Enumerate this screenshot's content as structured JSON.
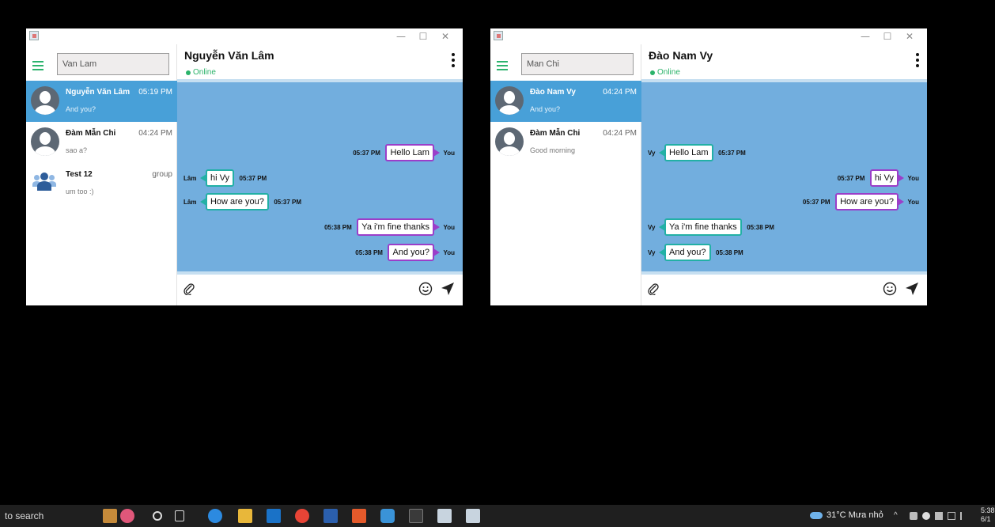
{
  "windows": [
    {
      "search": {
        "value": "Van Lam"
      },
      "conversations": [
        {
          "name": "Nguyễn Văn Lâm",
          "time": "05:19 PM",
          "last": "And you?",
          "active": true,
          "type": "user"
        },
        {
          "name": "Đàm Mẫn Chi",
          "time": "04:24 PM",
          "last": "sao a?",
          "active": false,
          "type": "user"
        },
        {
          "name": "Test 12",
          "time": "group",
          "last": "um too :)",
          "active": false,
          "type": "group"
        }
      ],
      "chat": {
        "title": "Nguyễn Văn Lâm",
        "status": "Online",
        "messages": [
          {
            "dir": "out",
            "sender": "You",
            "text": "Hello Lam",
            "time": "05:37 PM"
          },
          {
            "dir": "in",
            "sender": "Lâm",
            "text": "hi Vy",
            "time": "05:37 PM"
          },
          {
            "dir": "in",
            "sender": "Lâm",
            "text": "How are you?",
            "time": "05:37 PM"
          },
          {
            "dir": "out",
            "sender": "You",
            "text": "Ya i'm fine thanks",
            "time": "05:38 PM"
          },
          {
            "dir": "out",
            "sender": "You",
            "text": "And you?",
            "time": "05:38 PM"
          }
        ]
      }
    },
    {
      "search": {
        "value": "Man Chi"
      },
      "conversations": [
        {
          "name": "Đào Nam Vy",
          "time": "04:24 PM",
          "last": "And you?",
          "active": true,
          "type": "user"
        },
        {
          "name": "Đàm Mẫn Chi",
          "time": "04:24 PM",
          "last": "Good morning",
          "active": false,
          "type": "user"
        }
      ],
      "chat": {
        "title": "Đào Nam Vy",
        "status": "Online",
        "messages": [
          {
            "dir": "in",
            "sender": "Vy",
            "text": "Hello Lam",
            "time": "05:37 PM"
          },
          {
            "dir": "out",
            "sender": "You",
            "text": "hi Vy",
            "time": "05:37 PM"
          },
          {
            "dir": "out",
            "sender": "You",
            "text": "How are you?",
            "time": "05:37 PM"
          },
          {
            "dir": "in",
            "sender": "Vy",
            "text": "Ya i'm fine thanks",
            "time": "05:38 PM"
          },
          {
            "dir": "in",
            "sender": "Vy",
            "text": "And you?",
            "time": "05:38 PM"
          }
        ]
      }
    }
  ],
  "taskbar": {
    "search_placeholder": "to search",
    "weather": "31°C Mưa nhỏ",
    "time": "5:38",
    "date": "6/1"
  },
  "colors": {
    "sidebar_active": "#48a0d8",
    "chat_background": "#72aede",
    "outgoing_border": "#9b3ec9",
    "incoming_border": "#22b0a5",
    "online": "#2bb36a"
  }
}
